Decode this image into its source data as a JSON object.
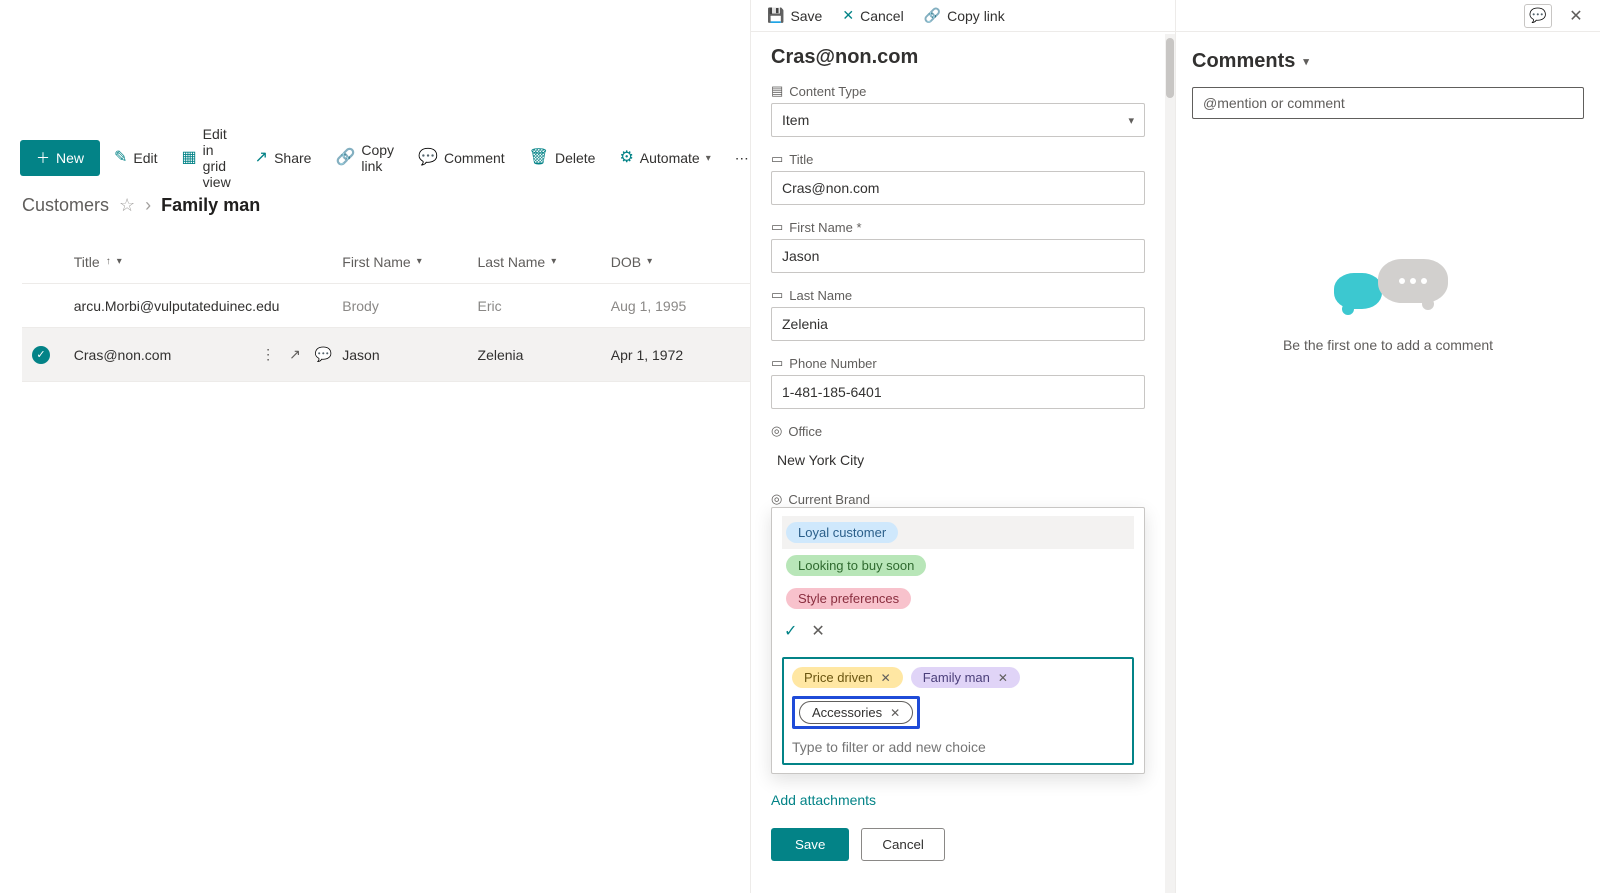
{
  "commands": {
    "new": "New",
    "edit": "Edit",
    "edit_grid": "Edit in grid view",
    "share": "Share",
    "copy_link": "Copy link",
    "comment": "Comment",
    "delete": "Delete",
    "automate": "Automate"
  },
  "breadcrumb": {
    "root": "Customers",
    "leaf": "Family man"
  },
  "grid": {
    "headers": {
      "title": "Title",
      "first": "First Name",
      "last": "Last Name",
      "dob": "DOB"
    },
    "rows": [
      {
        "title": "arcu.Morbi@vulputateduinec.edu",
        "first": "Brody",
        "last": "Eric",
        "dob": "Aug 1, 1995"
      },
      {
        "title": "Cras@non.com",
        "first": "Jason",
        "last": "Zelenia",
        "dob": "Apr 1, 1972"
      }
    ]
  },
  "panel": {
    "actions": {
      "save": "Save",
      "cancel": "Cancel",
      "copy_link": "Copy link"
    },
    "title": "Cras@non.com",
    "labels": {
      "content_type": "Content Type",
      "title": "Title",
      "first_name": "First Name *",
      "last_name": "Last Name",
      "phone": "Phone Number",
      "office": "Office",
      "current_brand": "Current Brand"
    },
    "values": {
      "content_type": "Item",
      "title": "Cras@non.com",
      "first_name": "Jason",
      "last_name": "Zelenia",
      "phone": "1-481-185-6401",
      "office": "New York City"
    },
    "choice_options": [
      {
        "label": "Loyal customer",
        "class": "pill-blue"
      },
      {
        "label": "Looking to buy soon",
        "class": "pill-green"
      },
      {
        "label": "Style preferences",
        "class": "pill-pink"
      }
    ],
    "choice_tags": [
      {
        "label": "Price driven",
        "class": "pill-yellow"
      },
      {
        "label": "Family man",
        "class": "pill-purple"
      },
      {
        "label": "Accessories",
        "class": "pill-outline",
        "highlight": true
      }
    ],
    "choice_placeholder": "Type to filter or add new choice",
    "add_attachments": "Add attachments",
    "save": "Save",
    "cancel": "Cancel"
  },
  "comments": {
    "title": "Comments",
    "placeholder": "@mention or comment",
    "empty": "Be the first one to add a comment"
  }
}
